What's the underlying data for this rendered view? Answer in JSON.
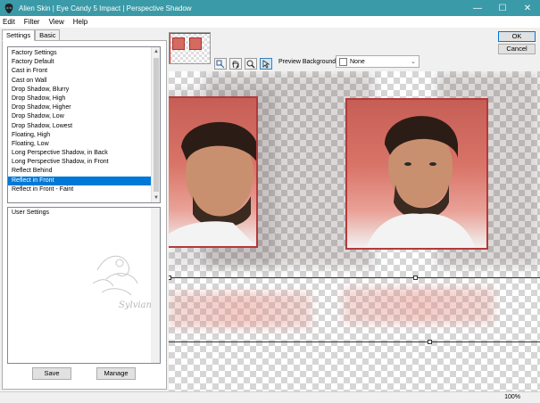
{
  "window": {
    "title": "Alien Skin | Eye Candy 5 Impact | Perspective Shadow",
    "icon": "alien-head-icon"
  },
  "menu": [
    {
      "label": "Edit"
    },
    {
      "label": "Filter"
    },
    {
      "label": "View"
    },
    {
      "label": "Help"
    }
  ],
  "tabs": {
    "settings": "Settings",
    "basic": "Basic"
  },
  "presets": {
    "header": "Factory Settings",
    "items": [
      "Factory Default",
      "Cast in Front",
      "Cast on Wall",
      "Drop Shadow, Blurry",
      "Drop Shadow, High",
      "Drop Shadow, Higher",
      "Drop Shadow, Low",
      "Drop Shadow, Lowest",
      "Floating, High",
      "Floating, Low",
      "Long Perspective Shadow, in Back",
      "Long Perspective Shadow, in Front",
      "Reflect Behind",
      "Reflect in Front",
      "Reflect in Front - Faint"
    ],
    "selected": "Reflect in Front"
  },
  "user_settings": {
    "header": "User Settings",
    "watermark": "Sylviane"
  },
  "buttons": {
    "save": "Save",
    "manage": "Manage",
    "ok": "OK",
    "cancel": "Cancel"
  },
  "preview_background": {
    "label": "Preview Background:",
    "value": "None"
  },
  "tools": [
    "move-preview-icon",
    "hand-icon",
    "zoom-icon",
    "arrow-select-icon"
  ],
  "status": {
    "zoom": "100%"
  },
  "colors": {
    "titlebar": "#3a9aa8",
    "selection": "#0078d7",
    "photo_border": "#b33a3a"
  }
}
